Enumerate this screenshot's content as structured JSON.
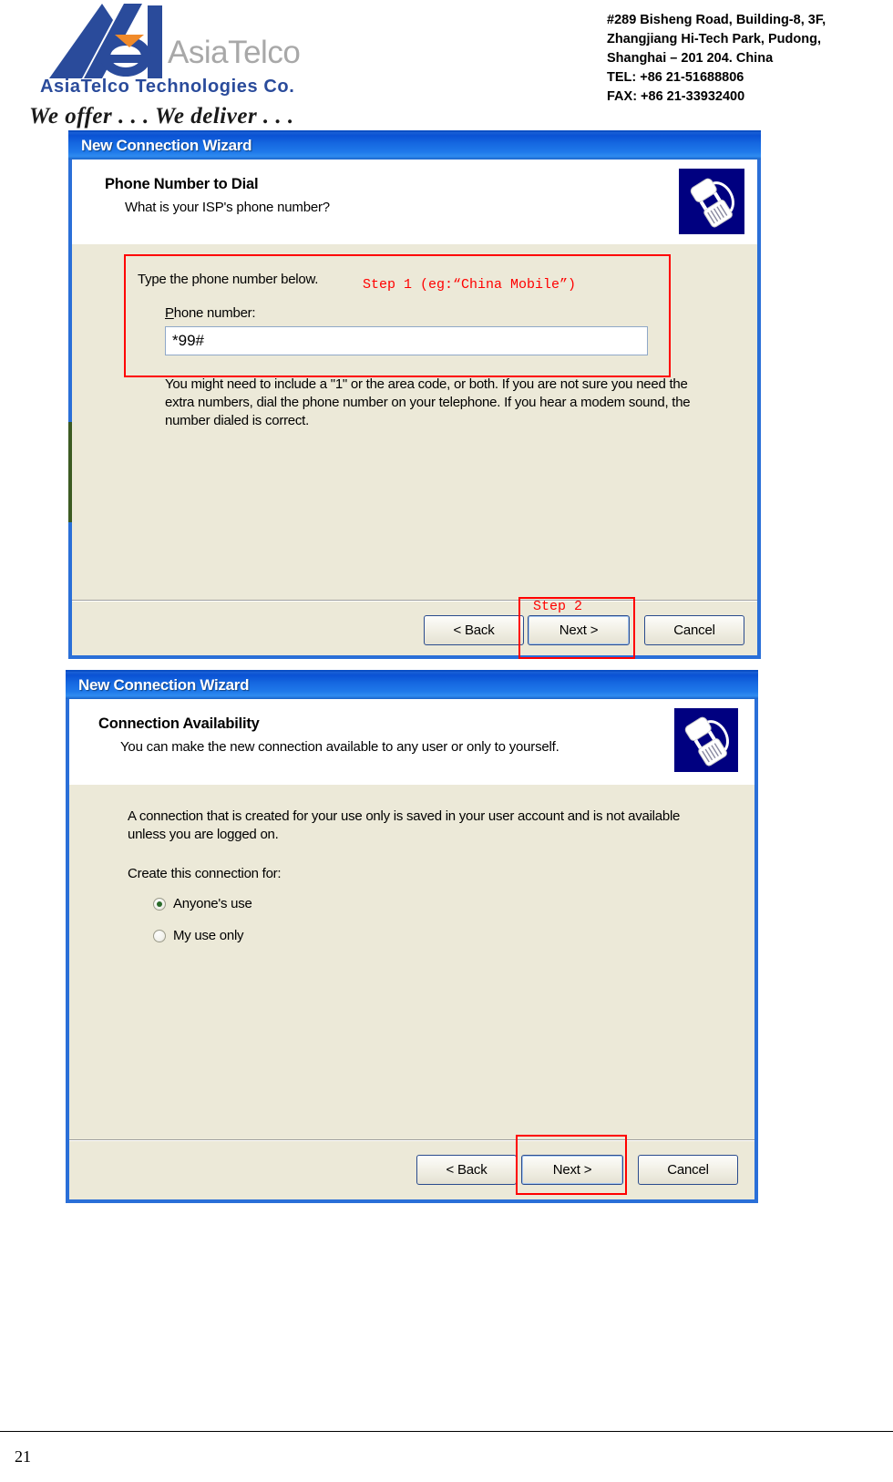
{
  "letterhead": {
    "logo_word": "AsiaTelco",
    "company": "AsiaTelco Technologies Co.",
    "tagline": "We offer . . . We deliver . . .",
    "address_lines": [
      "#289 Bisheng Road, Building-8, 3F,",
      "Zhangjiang Hi-Tech Park, Pudong,",
      "Shanghai – 201 204. China",
      "TEL: +86 21-51688806",
      "FAX: +86 21-33932400"
    ],
    "address_block": "#289 Bisheng Road, Building-8, 3F,\nZhangjiang Hi-Tech Park, Pudong,\nShanghai – 201 204. China\nTEL: +86 21-51688806\nFAX: +86 21-33932400"
  },
  "dialog1": {
    "titlebar": "New Connection Wizard",
    "header_title": "Phone Number to Dial",
    "header_sub": "What is your ISP's phone number?",
    "header_icon": "phone-modem-icon",
    "instruction": "Type the phone number below.",
    "field_label": "Phone number:",
    "field_value": "*99#",
    "hint": "You might need to include a \"1\" or the area code, or both. If you are not sure you need the extra numbers, dial the phone number on your telephone. If you hear a modem sound, the number dialed is correct.",
    "buttons": {
      "back": "< Back",
      "next": "Next >",
      "cancel": "Cancel"
    },
    "annotations": {
      "step1": "Step 1  (eg:“China Mobile”)",
      "step2": "Step 2"
    }
  },
  "dialog2": {
    "titlebar": "New Connection Wizard",
    "header_title": "Connection Availability",
    "header_sub": "You can make the new connection available to any user or only to yourself.",
    "header_icon": "phone-modem-icon",
    "body_text": "A connection that is created for your use only is saved in your user account and is not available unless you are logged on.",
    "group_label": "Create this connection for:",
    "options": [
      {
        "label": "Anyone's use",
        "checked": true
      },
      {
        "label": "My use only",
        "checked": false
      }
    ],
    "buttons": {
      "back": "< Back",
      "next": "Next >",
      "cancel": "Cancel"
    }
  },
  "footer": {
    "page_number": "21"
  },
  "colors": {
    "annotation_red": "#ff0000",
    "titlebar_blue": "#0a52d4",
    "dialog_face": "#ece9d8",
    "brand_blue": "#2a4b9b",
    "logo_gray": "#a8a8a8"
  }
}
